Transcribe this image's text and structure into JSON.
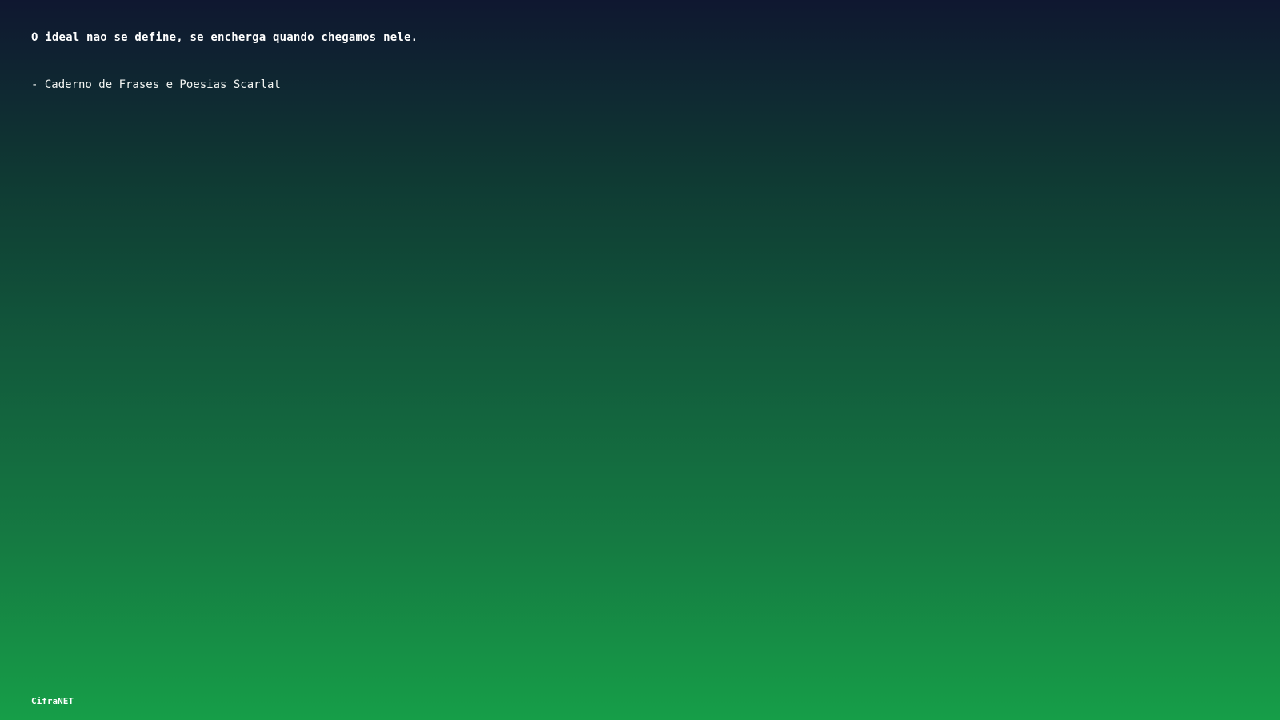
{
  "quote": {
    "text": "O ideal nao se define, se encherga quando chegamos nele.",
    "attribution": "- Caderno de Frases e Poesias Scarlat"
  },
  "footer": {
    "brand": "CifraNET"
  },
  "colors": {
    "gradient_top": "#0f1730",
    "gradient_bottom": "#169e48",
    "text": "#ffffff"
  }
}
